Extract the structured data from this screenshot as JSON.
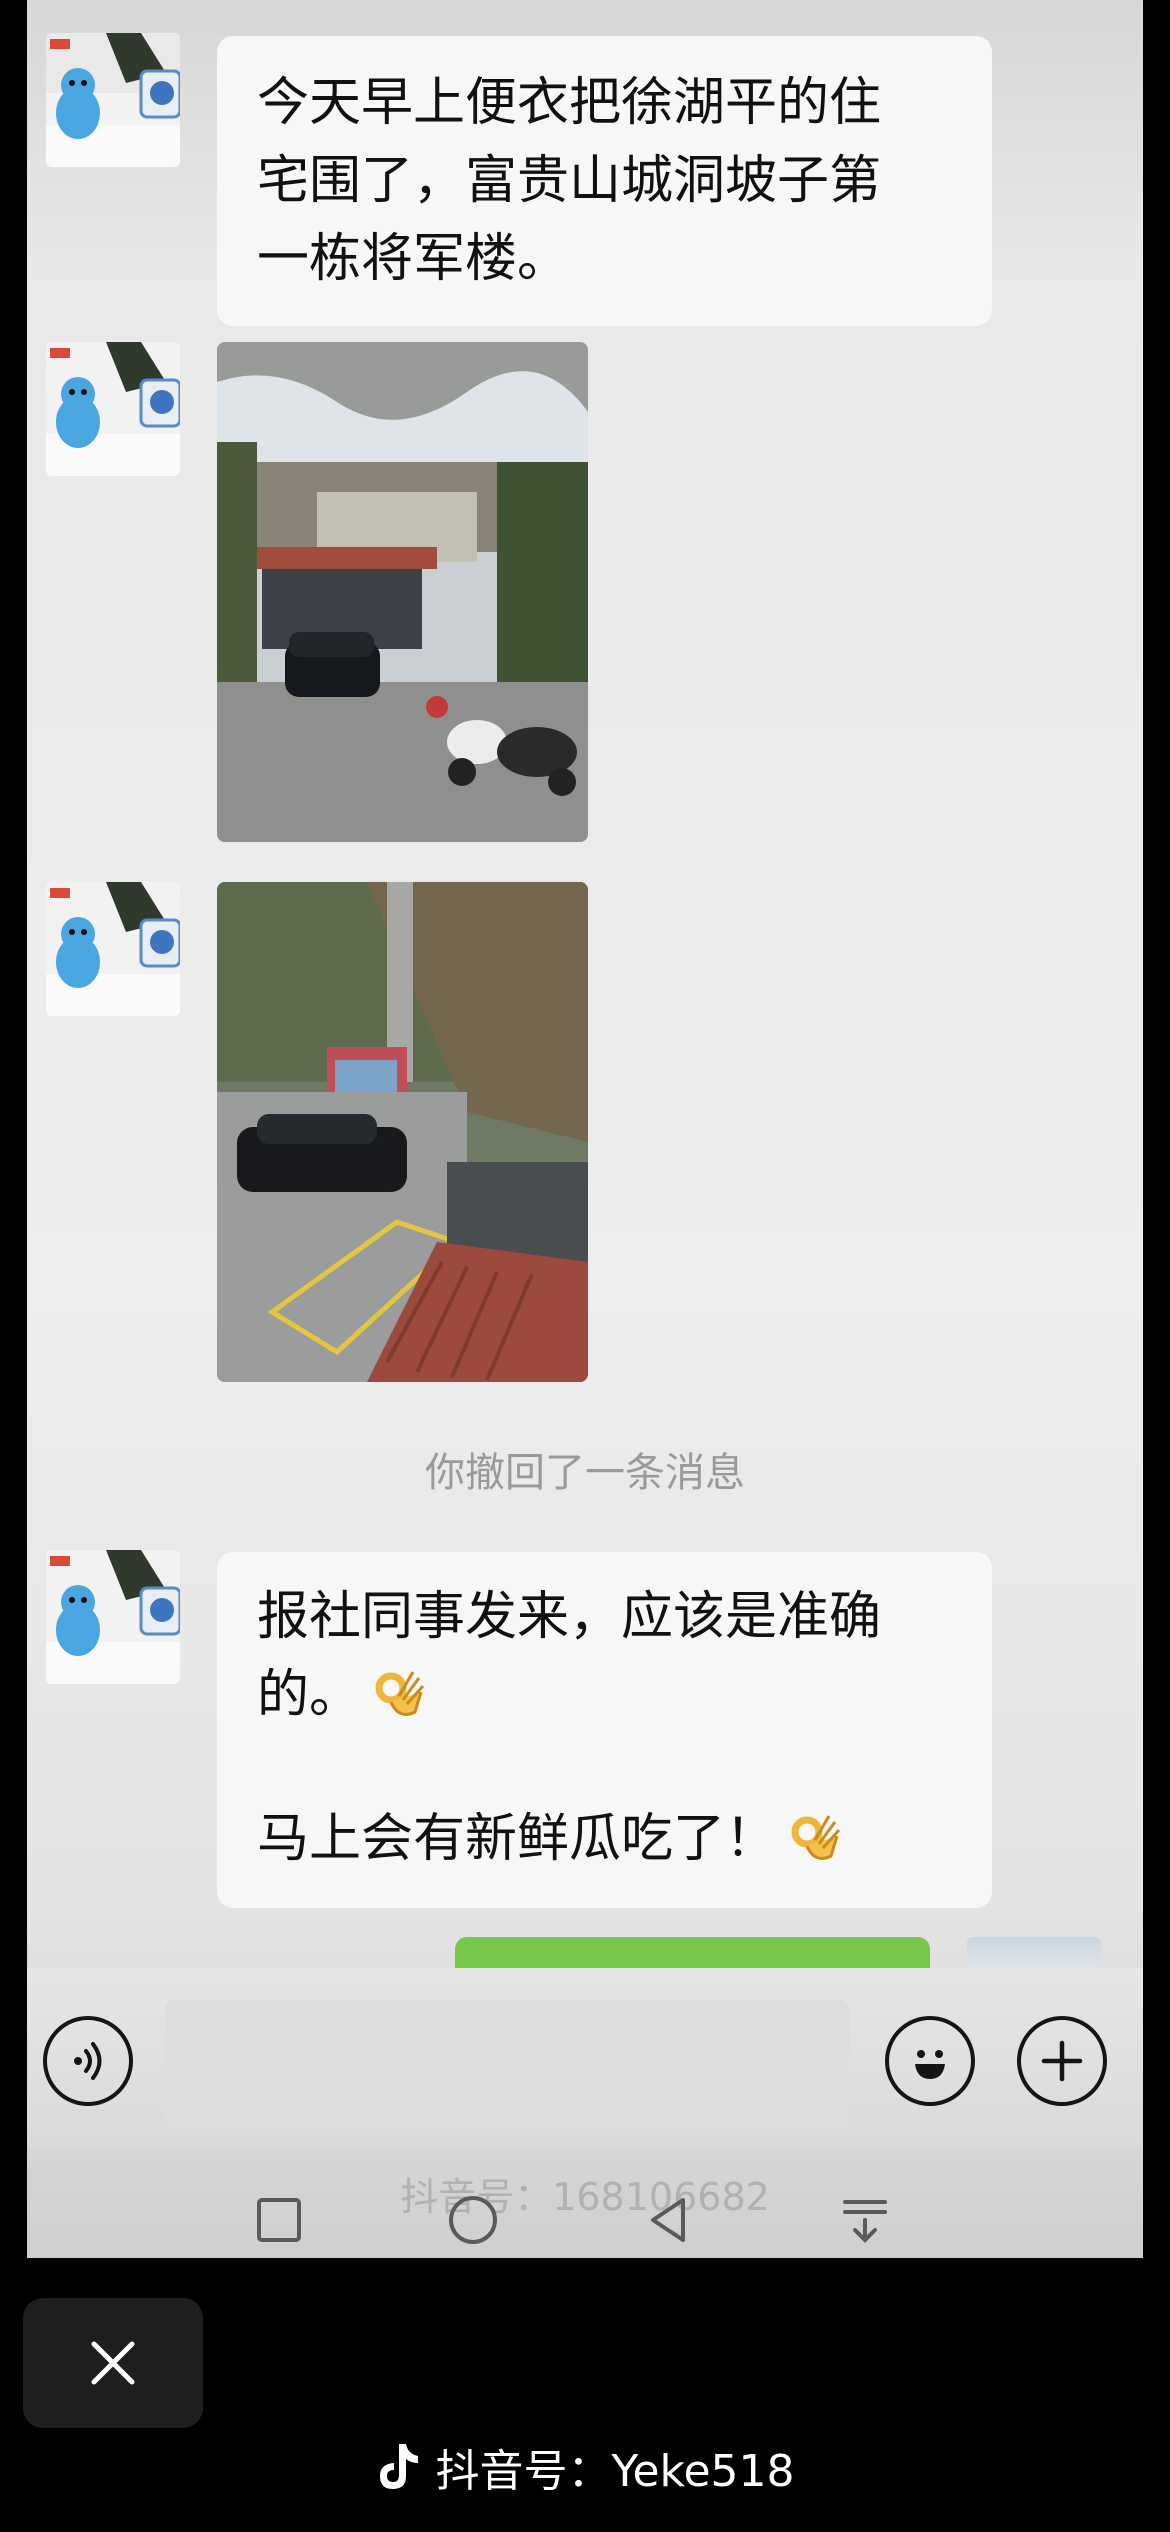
{
  "messages": {
    "msg1_lines": [
      "今天早上便衣把徐湖平的住",
      "宅围了，富贵山城洞坡子第",
      "一栋将军楼。"
    ],
    "recall_notice": "你撤回了一条消息",
    "msg4_lines": [
      "报社同事发来，应该是准确",
      "的。",
      "马上会有新鲜瓜吃了！"
    ],
    "ok_emoji": "ok-hand-emoji"
  },
  "input_bar": {
    "voice_icon": "voice-icon",
    "emoji_icon": "smiley-icon",
    "plus_icon": "plus-icon",
    "message_value": ""
  },
  "watermarks": {
    "inner": "抖音号：168106682",
    "account": "抖音号：Yeke518"
  },
  "colors": {
    "green_bubble": "#77c84a",
    "bubble_bg": "#f7f7f7",
    "recall_text": "#9a9a9a"
  }
}
